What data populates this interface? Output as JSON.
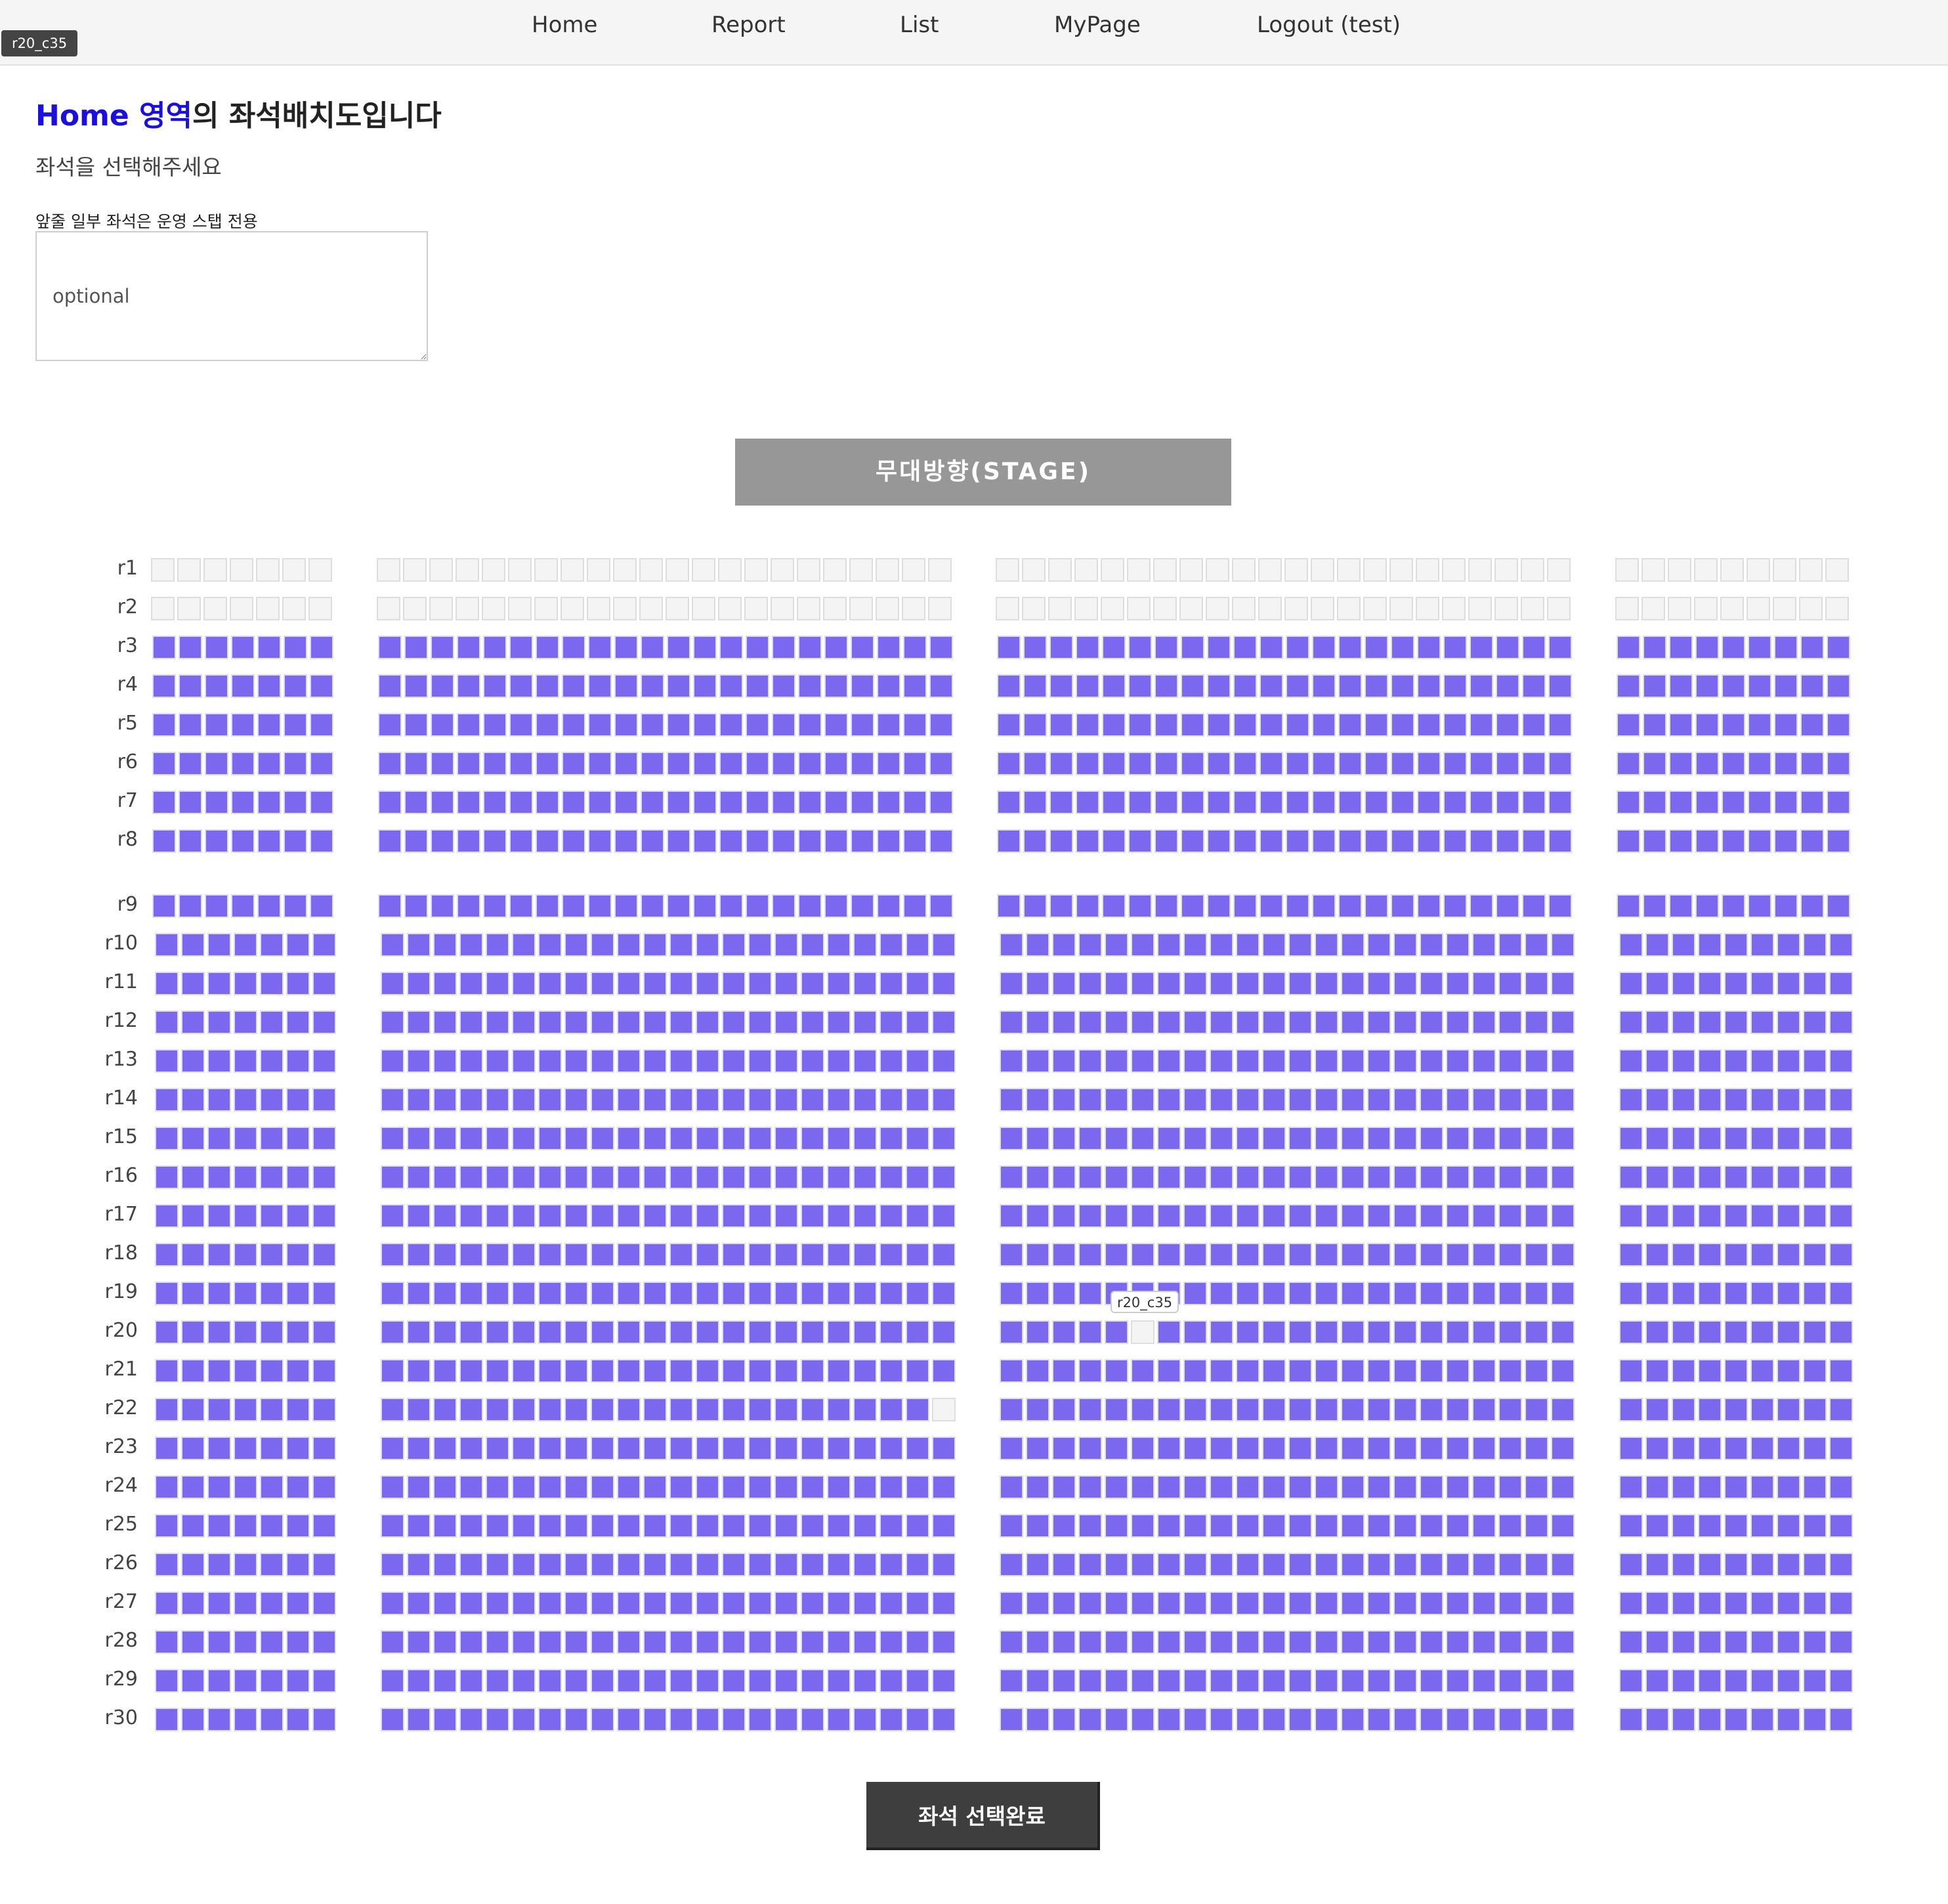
{
  "nav": {
    "items": [
      "Home",
      "Report",
      "List",
      "MyPage",
      "Logout (test)"
    ]
  },
  "hover_tooltip": "r20_c35",
  "heading": {
    "highlight": "Home 영역",
    "rest": "의 좌석배치도입니다"
  },
  "subtitle": "좌석을 선택해주세요",
  "note": "앞줄 일부 좌석은 운영 스탭 전용",
  "memo": {
    "placeholder": "optional"
  },
  "stage_label": "무대방향(STAGE)",
  "seat_map": {
    "rows": [
      "r1",
      "r2",
      "r3",
      "r4",
      "r5",
      "r6",
      "r7",
      "r8",
      "r9",
      "r10",
      "r11",
      "r12",
      "r13",
      "r14",
      "r15",
      "r16",
      "r17",
      "r18",
      "r19",
      "r20",
      "r21",
      "r22",
      "r23",
      "r24",
      "r25",
      "r26",
      "r27",
      "r28",
      "r29",
      "r30"
    ],
    "section_seat_counts": [
      7,
      22,
      22,
      9
    ],
    "unavailable_rows": [
      "r1",
      "r2"
    ],
    "unavailable_seats": [
      "r20_c35",
      "r22_c29"
    ],
    "hovered_seat": "r20_c35",
    "hovered_seat_label": "r20_c35",
    "colors": {
      "available": "#7b68ee",
      "unavailable": "#f4f4f4"
    }
  },
  "submit_label": "좌석 선택완료"
}
